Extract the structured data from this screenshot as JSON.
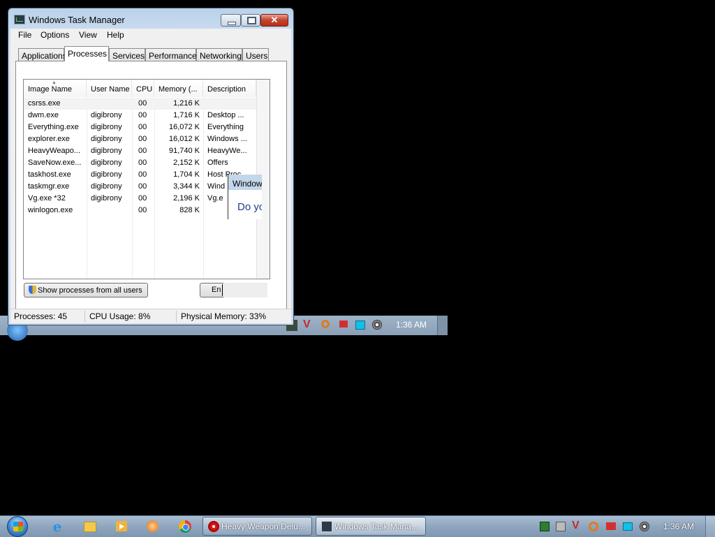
{
  "window": {
    "title": "Windows Task Manager",
    "menu": [
      "File",
      "Options",
      "View",
      "Help"
    ],
    "tabs": [
      "Applications",
      "Processes",
      "Services",
      "Performance",
      "Networking",
      "Users"
    ],
    "active_tab": "Processes",
    "columns": [
      "Image Name",
      "User Name",
      "CPU",
      "Memory (...",
      "Description"
    ],
    "rows": [
      {
        "image": "csrss.exe",
        "user": "",
        "cpu": "00",
        "mem": "1,216 K",
        "desc": ""
      },
      {
        "image": "dwm.exe",
        "user": "digibrony",
        "cpu": "00",
        "mem": "1,716 K",
        "desc": "Desktop ..."
      },
      {
        "image": "Everything.exe",
        "user": "digibrony",
        "cpu": "00",
        "mem": "16,072 K",
        "desc": "Everything"
      },
      {
        "image": "explorer.exe",
        "user": "digibrony",
        "cpu": "00",
        "mem": "16,012 K",
        "desc": "Windows ..."
      },
      {
        "image": "HeavyWeapo...",
        "user": "digibrony",
        "cpu": "00",
        "mem": "91,740 K",
        "desc": "HeavyWe..."
      },
      {
        "image": "SaveNow.exe...",
        "user": "digibrony",
        "cpu": "00",
        "mem": "2,152 K",
        "desc": "Offers"
      },
      {
        "image": "taskhost.exe",
        "user": "digibrony",
        "cpu": "00",
        "mem": "1,704 K",
        "desc": "Host Proc..."
      },
      {
        "image": "taskmgr.exe",
        "user": "digibrony",
        "cpu": "00",
        "mem": "3,344 K",
        "desc": "Wind"
      },
      {
        "image": "Vg.exe *32",
        "user": "digibrony",
        "cpu": "00",
        "mem": "2,196 K",
        "desc": "Vg.e"
      },
      {
        "image": "winlogon.exe",
        "user": "",
        "cpu": "00",
        "mem": "828 K",
        "desc": ""
      }
    ],
    "show_all_button": "Show processes from all users",
    "end_button": "En",
    "status": {
      "processes": "Processes: 45",
      "cpu": "CPU Usage: 8%",
      "memory": "Physical Memory: 33%"
    }
  },
  "ghost_dialog": {
    "title": "Window",
    "text": "Do yo"
  },
  "ghost_clock": "1:36 AM",
  "taskbar": {
    "buttons": [
      {
        "label": "Heavy Weapon Delu..."
      },
      {
        "label": "Windows Task Mana..."
      }
    ],
    "clock": "1:36 AM"
  }
}
